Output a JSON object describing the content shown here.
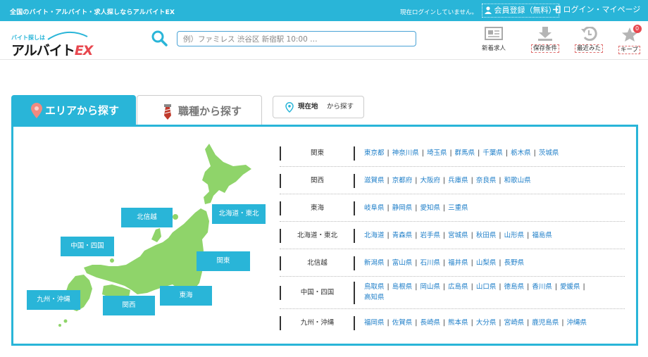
{
  "topbar": {
    "tagline": "全国のバイト・アルバイト・求人探しならアルバイトEX",
    "login_status": "現在ログインしていません。",
    "register_label": "会員登録（無料）",
    "login_label": "ログイン・マイページ"
  },
  "header": {
    "logo_small": "バイト探しは",
    "logo_main": "アルバイト",
    "logo_ex": "EX",
    "search_placeholder": "例）ファミレス 渋谷区 新宿駅 10:00 …",
    "icons": [
      {
        "name": "new-jobs",
        "label": "新着求人"
      },
      {
        "name": "saved-conditions",
        "label": "保存条件"
      },
      {
        "name": "recently-viewed",
        "label": "最近みた"
      },
      {
        "name": "keep",
        "label": "キープ",
        "badge": "0"
      }
    ]
  },
  "tabs": {
    "area_label": "エリアから探す",
    "job_label": "職種から探す"
  },
  "location_button": {
    "bold": "現在地",
    "rest": "から探す"
  },
  "map": {
    "labels": [
      {
        "key": "hokushinetsu",
        "text": "北信越"
      },
      {
        "key": "hokkaido-tohoku",
        "text": "北海道・東北"
      },
      {
        "key": "chugoku-shikoku",
        "text": "中国・四国"
      },
      {
        "key": "kanto",
        "text": "関東"
      },
      {
        "key": "kyushu-okinawa",
        "text": "九州・沖縄"
      },
      {
        "key": "tokai",
        "text": "東海"
      },
      {
        "key": "kansai",
        "text": "関西"
      }
    ]
  },
  "regions": [
    {
      "name": "関東",
      "prefs": [
        "東京都",
        "神奈川県",
        "埼玉県",
        "群馬県",
        "千葉県",
        "栃木県",
        "茨城県"
      ]
    },
    {
      "name": "関西",
      "prefs": [
        "滋賀県",
        "京都府",
        "大阪府",
        "兵庫県",
        "奈良県",
        "和歌山県"
      ]
    },
    {
      "name": "東海",
      "prefs": [
        "岐阜県",
        "静岡県",
        "愛知県",
        "三重県"
      ]
    },
    {
      "name": "北海道・東北",
      "prefs": [
        "北海道",
        "青森県",
        "岩手県",
        "宮城県",
        "秋田県",
        "山形県",
        "福島県"
      ]
    },
    {
      "name": "北信越",
      "prefs": [
        "新潟県",
        "富山県",
        "石川県",
        "福井県",
        "山梨県",
        "長野県"
      ]
    },
    {
      "name": "中国・四国",
      "prefs": [
        "鳥取県",
        "島根県",
        "岡山県",
        "広島県",
        "山口県",
        "徳島県",
        "香川県",
        "愛媛県",
        "高知県"
      ]
    },
    {
      "name": "九州・沖縄",
      "prefs": [
        "福岡県",
        "佐賀県",
        "長崎県",
        "熊本県",
        "大分県",
        "宮崎県",
        "鹿児島県",
        "沖縄県"
      ]
    }
  ],
  "colors": {
    "accent": "#29b5d8",
    "map_land": "#8fd46a",
    "link": "#1e7ec8",
    "badge": "#e8484f"
  }
}
